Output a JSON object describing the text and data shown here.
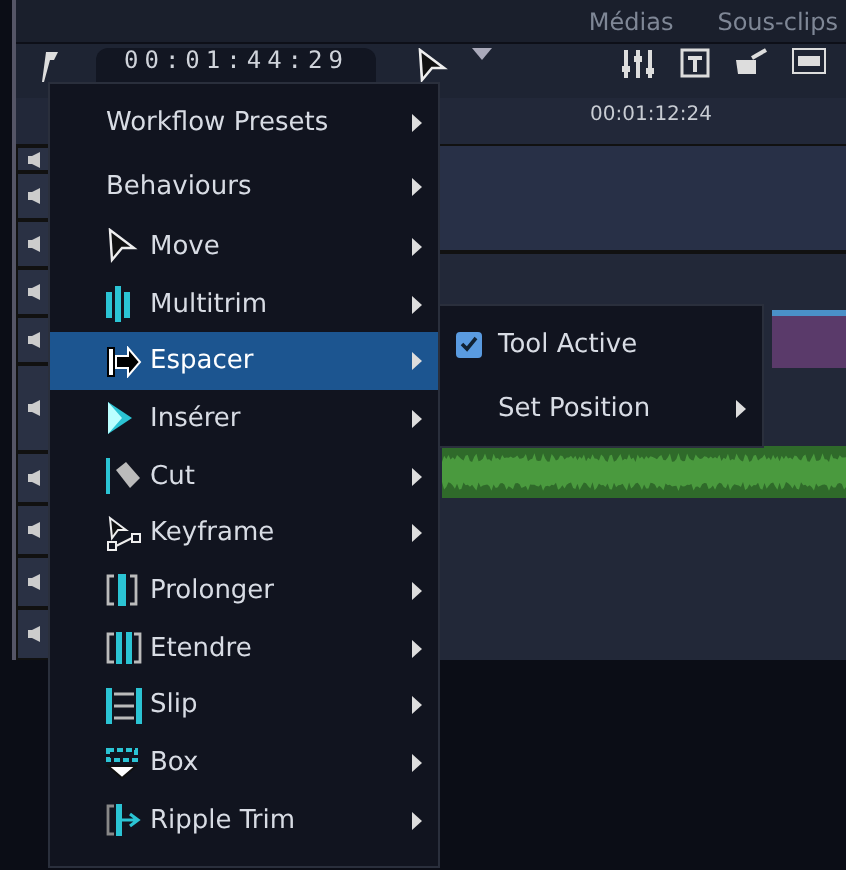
{
  "header": {
    "tabs": [
      {
        "label": "Médias"
      },
      {
        "label": "Sous-clips"
      }
    ]
  },
  "toolbar": {
    "timecode": "00:01:44:29"
  },
  "ruler": {
    "time": "00:01:12:24"
  },
  "menu": {
    "items": [
      {
        "label": "Workflow Presets",
        "kind": "plain",
        "selected": false
      },
      {
        "label": "Behaviours",
        "kind": "plain",
        "selected": false
      },
      {
        "label": "Move",
        "kind": "tool",
        "selected": false
      },
      {
        "label": "Multitrim",
        "kind": "tool",
        "selected": false
      },
      {
        "label": "Espacer",
        "kind": "tool",
        "selected": true,
        "submenu": [
          {
            "label": "Tool Active",
            "kind": "check",
            "checked": true
          },
          {
            "label": "Set Position",
            "kind": "submenu"
          }
        ]
      },
      {
        "label": "Insérer",
        "kind": "tool",
        "selected": false
      },
      {
        "label": "Cut",
        "kind": "tool",
        "selected": false
      },
      {
        "label": "Keyframe",
        "kind": "tool",
        "selected": false
      },
      {
        "label": "Prolonger",
        "kind": "tool",
        "selected": false
      },
      {
        "label": "Etendre",
        "kind": "tool",
        "selected": false
      },
      {
        "label": "Slip",
        "kind": "tool",
        "selected": false
      },
      {
        "label": "Box",
        "kind": "tool",
        "selected": false
      },
      {
        "label": "Ripple Trim",
        "kind": "tool",
        "selected": false
      }
    ]
  }
}
